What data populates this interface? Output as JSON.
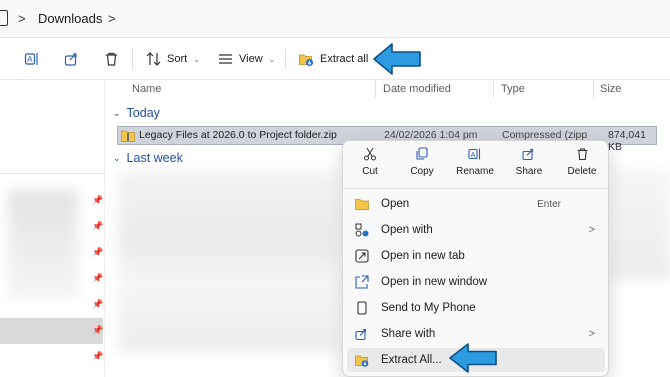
{
  "breadcrumb": {
    "separator": ">",
    "location": "Downloads"
  },
  "toolbar": {
    "sort_label": "Sort",
    "view_label": "View",
    "extract_all_label": "Extract all",
    "icons": [
      "rename-icon",
      "share-icon",
      "delete-icon",
      "sort-icon",
      "view-icon",
      "extract-icon"
    ]
  },
  "columns": {
    "name": "Name",
    "date": "Date modified",
    "type": "Type",
    "size": "Size"
  },
  "groups": {
    "today": "Today",
    "last_week": "Last week"
  },
  "selected_file": {
    "name": "Legacy Files at 2026.0 to Project folder.zip",
    "date": "24/02/2026 1:04 pm",
    "type": "Compressed (zipp",
    "size": "874,041 KB"
  },
  "context_menu": {
    "quick_actions": [
      {
        "label": "Cut",
        "icon": "cut-icon"
      },
      {
        "label": "Copy",
        "icon": "copy-icon"
      },
      {
        "label": "Rename",
        "icon": "rename-icon"
      },
      {
        "label": "Share",
        "icon": "share-icon"
      },
      {
        "label": "Delete",
        "icon": "delete-icon"
      }
    ],
    "items": [
      {
        "label": "Open",
        "shortcut": "Enter",
        "icon": "folder-icon"
      },
      {
        "label": "Open with",
        "submenu": ">",
        "icon": "open-with-icon"
      },
      {
        "label": "Open in new tab",
        "icon": "new-tab-icon"
      },
      {
        "label": "Open in new window",
        "icon": "new-window-icon"
      },
      {
        "label": "Send to My Phone",
        "icon": "phone-icon"
      },
      {
        "label": "Share with",
        "submenu": ">",
        "icon": "share-with-icon"
      },
      {
        "label": "Extract All...",
        "icon": "extract-icon",
        "highlighted": true
      }
    ]
  },
  "colors": {
    "accent": "#1f4fa3",
    "callout_arrow": "#2d9be0",
    "selection": "#cfd4dc"
  }
}
